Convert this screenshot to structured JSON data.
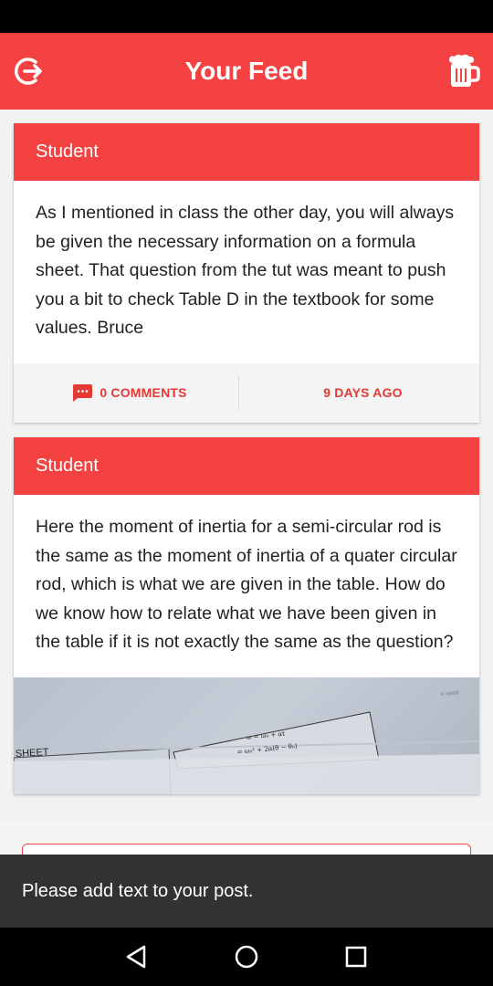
{
  "app_bar": {
    "title": "Your Feed",
    "left_icon": "logout-icon",
    "right_icon": "beer-mug-icon",
    "color": "#f44141"
  },
  "posts": [
    {
      "author": "Student",
      "body": "As I mentioned in class the other day, you will always be given the necessary information on a formula sheet. That question from the tut was meant to push you a bit to check Table D in the textbook for some values. Bruce",
      "comments": "0 COMMENTS",
      "age": "9 DAYS AGO"
    },
    {
      "author": "Student",
      "body": "Here the moment of inertia for a semi-circular rod is the same as the moment of inertia of a quater circular rod, which is what we are given in the table. How do we know how to relate what we have been given in the table if it is not exactly the same as the question?",
      "image": {
        "caption_sheet": "SHEET",
        "formula_1": "ω = ω₀ + αt",
        "formula_2": "= ω₀² + 2α(θ − θ₀)",
        "corner_text": "e used"
      }
    }
  ],
  "snackbar": {
    "message": "Please add text to your post."
  },
  "nav": {
    "back_icon": "back-triangle-icon",
    "home_icon": "home-circle-icon",
    "recents_icon": "recents-square-icon"
  }
}
